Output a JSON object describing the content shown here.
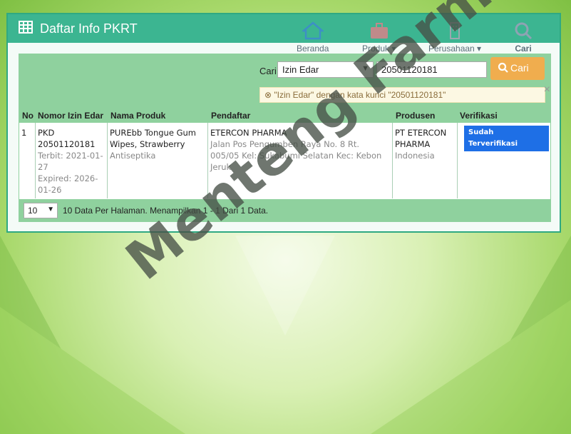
{
  "header": {
    "title": "Daftar Info PKRT",
    "nav": [
      {
        "label": "Beranda",
        "icon": "home-icon"
      },
      {
        "label": "Produk",
        "icon": "briefcase-icon"
      },
      {
        "label": "Perusahaan",
        "icon": "building-icon"
      },
      {
        "label": "Cari",
        "icon": "search-icon"
      }
    ]
  },
  "search": {
    "label": "Cari",
    "select_value": "Izin Edar",
    "input_value": "20501120181",
    "button_label": "Cari",
    "alert_text": "\"Izin Edar\" dengan kata kunci \"20501120181\""
  },
  "table": {
    "headers": [
      "No",
      "Nomor Izin Edar",
      "Nama Produk",
      "Pendaftar",
      "Produsen",
      "Verifikasi"
    ],
    "rows": [
      {
        "no": "1",
        "izin": "PKD 20501120181",
        "terbit": "Terbit: 2021-01-27",
        "expired": "Expired: 2026-01-26",
        "produk": "PUREbb Tongue Gum Wipes, Strawberry",
        "kategori": "Antiseptika",
        "pendaftar": "ETERCON PHARMA",
        "alamat": "Jalan Pos Pengumben Raya No. 8 Rt. 005/05 Kel: Sukabumi Selatan Kec: Kebon Jeruk",
        "produsen": "PT ETERCON PHARMA",
        "negara": "Indonesia",
        "verifikasi": "Sudah Terverifikasi"
      }
    ]
  },
  "footer": {
    "per_page": "10",
    "text": "10 Data Per Halaman. Menampilkan 1 - 1 Dari 1 Data."
  },
  "watermark": "Menteng Farma",
  "colors": {
    "header": "#3cb591",
    "table_header": "#8fd19e",
    "button": "#f0ad4e",
    "badge": "#1e6fe6"
  }
}
